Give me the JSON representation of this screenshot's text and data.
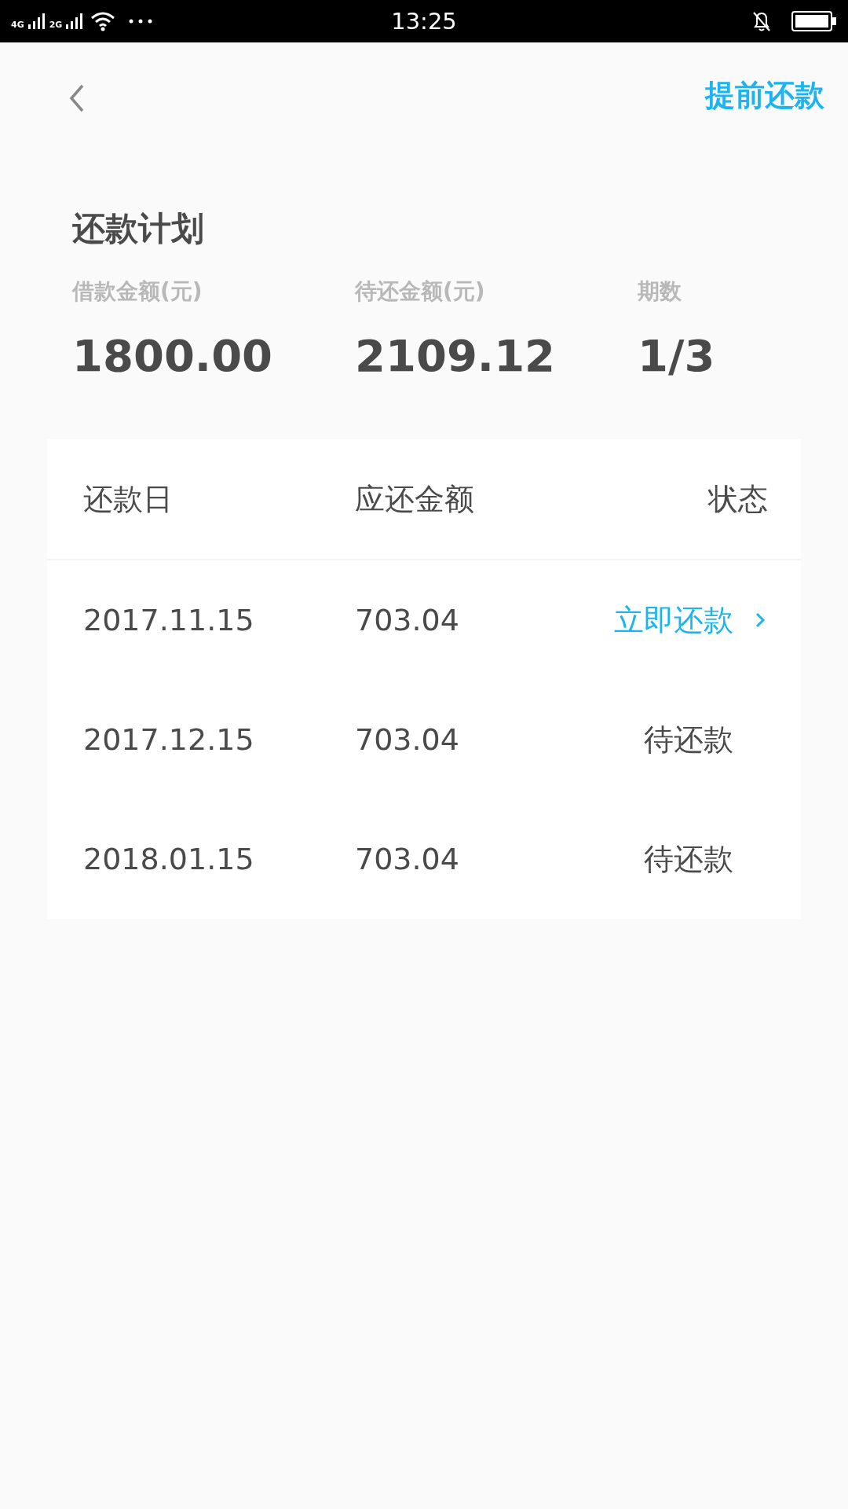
{
  "status_bar": {
    "network_1": "4G",
    "network_2": "2G",
    "time": "13:25"
  },
  "nav": {
    "action": "提前还款"
  },
  "title": "还款计划",
  "summary": [
    {
      "label": "借款金额(元)",
      "value": "1800.00"
    },
    {
      "label": "待还金额(元)",
      "value": "2109.12"
    },
    {
      "label": "期数",
      "value": "1/3"
    }
  ],
  "table": {
    "columns": [
      "还款日",
      "应还金额",
      "状态"
    ],
    "rows": [
      {
        "date": "2017.11.15",
        "amount": "703.04",
        "status": "立即还款",
        "kind": "action"
      },
      {
        "date": "2017.12.15",
        "amount": "703.04",
        "status": "待还款",
        "kind": "pending"
      },
      {
        "date": "2018.01.15",
        "amount": "703.04",
        "status": "待还款",
        "kind": "pending"
      }
    ]
  }
}
